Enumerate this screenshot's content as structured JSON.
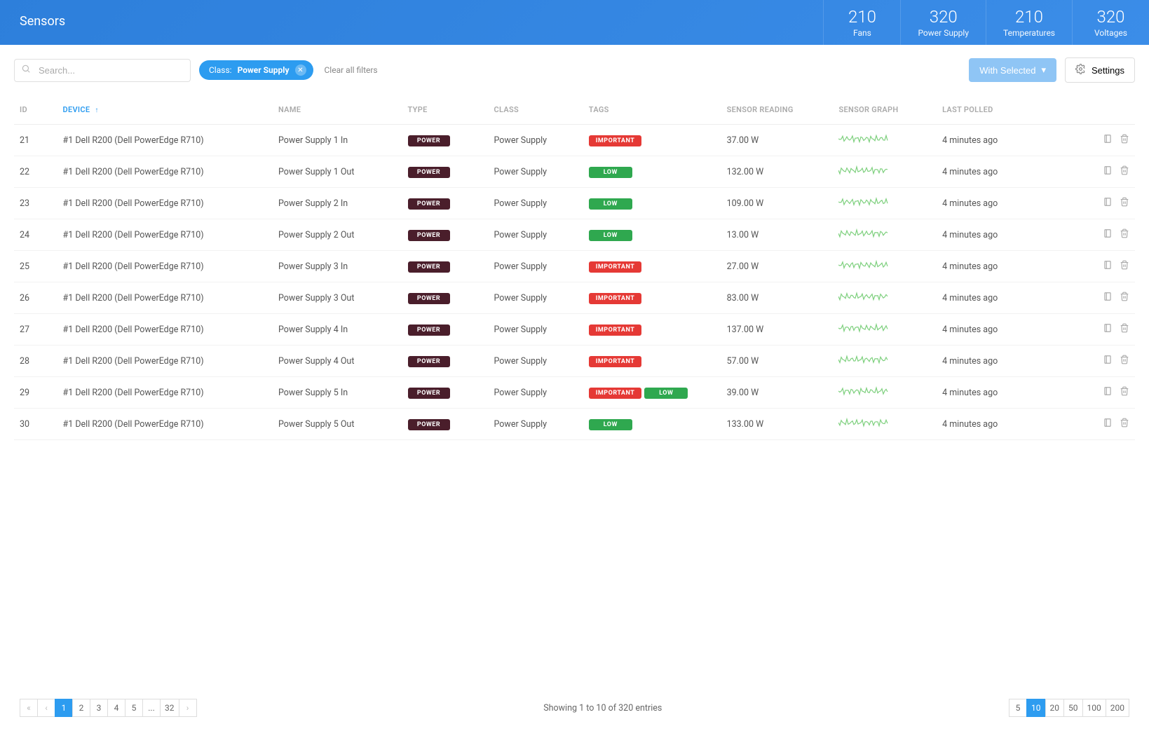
{
  "header": {
    "title": "Sensors",
    "stats": [
      {
        "value": "210",
        "label": "Fans"
      },
      {
        "value": "320",
        "label": "Power Supply"
      },
      {
        "value": "210",
        "label": "Temperatures"
      },
      {
        "value": "320",
        "label": "Voltages"
      }
    ]
  },
  "toolbar": {
    "search_placeholder": "Search...",
    "filter_chip_label": "Class:",
    "filter_chip_value": "Power Supply",
    "clear_filters": "Clear all filters",
    "with_selected": "With Selected",
    "settings": "Settings"
  },
  "columns": {
    "id": "ID",
    "device": "DEVICE",
    "name": "NAME",
    "type": "TYPE",
    "class": "CLASS",
    "tags": "TAGS",
    "reading": "SENSOR READING",
    "graph": "SENSOR GRAPH",
    "polled": "LAST POLLED"
  },
  "type_badge": "POWER",
  "tag_labels": {
    "important": "IMPORTANT",
    "low": "LOW"
  },
  "rows": [
    {
      "id": "21",
      "device": "#1 Dell R200 (Dell PowerEdge R710)",
      "name": "Power Supply 1 In",
      "class": "Power Supply",
      "tags": [
        "important"
      ],
      "reading": "37.00 W",
      "polled": "4 minutes ago"
    },
    {
      "id": "22",
      "device": "#1 Dell R200 (Dell PowerEdge R710)",
      "name": "Power Supply 1 Out",
      "class": "Power Supply",
      "tags": [
        "low"
      ],
      "reading": "132.00 W",
      "polled": "4 minutes ago"
    },
    {
      "id": "23",
      "device": "#1 Dell R200 (Dell PowerEdge R710)",
      "name": "Power Supply 2 In",
      "class": "Power Supply",
      "tags": [
        "low"
      ],
      "reading": "109.00 W",
      "polled": "4 minutes ago"
    },
    {
      "id": "24",
      "device": "#1 Dell R200 (Dell PowerEdge R710)",
      "name": "Power Supply 2 Out",
      "class": "Power Supply",
      "tags": [
        "low"
      ],
      "reading": "13.00 W",
      "polled": "4 minutes ago"
    },
    {
      "id": "25",
      "device": "#1 Dell R200 (Dell PowerEdge R710)",
      "name": "Power Supply 3 In",
      "class": "Power Supply",
      "tags": [
        "important"
      ],
      "reading": "27.00 W",
      "polled": "4 minutes ago"
    },
    {
      "id": "26",
      "device": "#1 Dell R200 (Dell PowerEdge R710)",
      "name": "Power Supply 3 Out",
      "class": "Power Supply",
      "tags": [
        "important"
      ],
      "reading": "83.00 W",
      "polled": "4 minutes ago"
    },
    {
      "id": "27",
      "device": "#1 Dell R200 (Dell PowerEdge R710)",
      "name": "Power Supply 4 In",
      "class": "Power Supply",
      "tags": [
        "important"
      ],
      "reading": "137.00 W",
      "polled": "4 minutes ago"
    },
    {
      "id": "28",
      "device": "#1 Dell R200 (Dell PowerEdge R710)",
      "name": "Power Supply 4 Out",
      "class": "Power Supply",
      "tags": [
        "important"
      ],
      "reading": "57.00 W",
      "polled": "4 minutes ago"
    },
    {
      "id": "29",
      "device": "#1 Dell R200 (Dell PowerEdge R710)",
      "name": "Power Supply 5 In",
      "class": "Power Supply",
      "tags": [
        "important",
        "low"
      ],
      "reading": "39.00 W",
      "polled": "4 minutes ago"
    },
    {
      "id": "30",
      "device": "#1 Dell R200 (Dell PowerEdge R710)",
      "name": "Power Supply 5 Out",
      "class": "Power Supply",
      "tags": [
        "low"
      ],
      "reading": "133.00 W",
      "polled": "4 minutes ago"
    }
  ],
  "footer": {
    "info": "Showing 1 to 10 of 320 entries",
    "pages": [
      "1",
      "2",
      "3",
      "4",
      "5",
      "...",
      "32"
    ],
    "active_page": "1",
    "sizes": [
      "5",
      "10",
      "20",
      "50",
      "100",
      "200"
    ],
    "active_size": "10"
  }
}
